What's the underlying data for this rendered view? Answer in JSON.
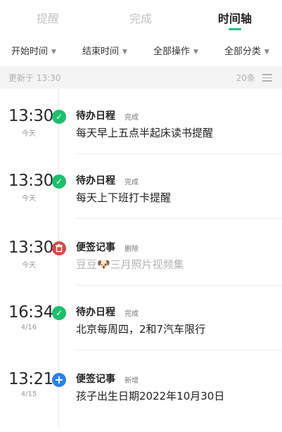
{
  "tabs": [
    {
      "label": "提醒"
    },
    {
      "label": "完成"
    },
    {
      "label": "时间轴"
    }
  ],
  "filters": [
    {
      "label": "开始时间"
    },
    {
      "label": "结束时间"
    },
    {
      "label": "全部操作"
    },
    {
      "label": "全部分类"
    }
  ],
  "status_bar": {
    "updated": "更新于 13:30",
    "count": "20条",
    "icon": "list-icon"
  },
  "timeline": [
    {
      "time": "13:30",
      "day": "今天",
      "type": "待办日程",
      "status": "完成",
      "title": "每天早上五点半起床读书提醒",
      "icon": "check-icon",
      "color": "#1dbf6e"
    },
    {
      "time": "13:30",
      "day": "今天",
      "type": "待办日程",
      "status": "完成",
      "title": "每天上下班打卡提醒",
      "icon": "check-icon",
      "color": "#1dbf6e"
    },
    {
      "time": "13:30",
      "day": "今天",
      "type": "便签记事",
      "status": "删除",
      "title": "豆豆🐶三月照片视频集",
      "icon": "trash-icon",
      "color": "#d14b4b"
    },
    {
      "time": "16:34",
      "day": "4/16",
      "type": "待办日程",
      "status": "完成",
      "title": "北京每周四，2和7汽车限行",
      "icon": "check-icon",
      "color": "#1dbf6e"
    },
    {
      "time": "13:21",
      "day": "4/15",
      "type": "便签记事",
      "status": "新增",
      "title": "孩子出生日期2022年10月30日",
      "icon": "plus-icon",
      "color": "#2d82e6"
    }
  ]
}
